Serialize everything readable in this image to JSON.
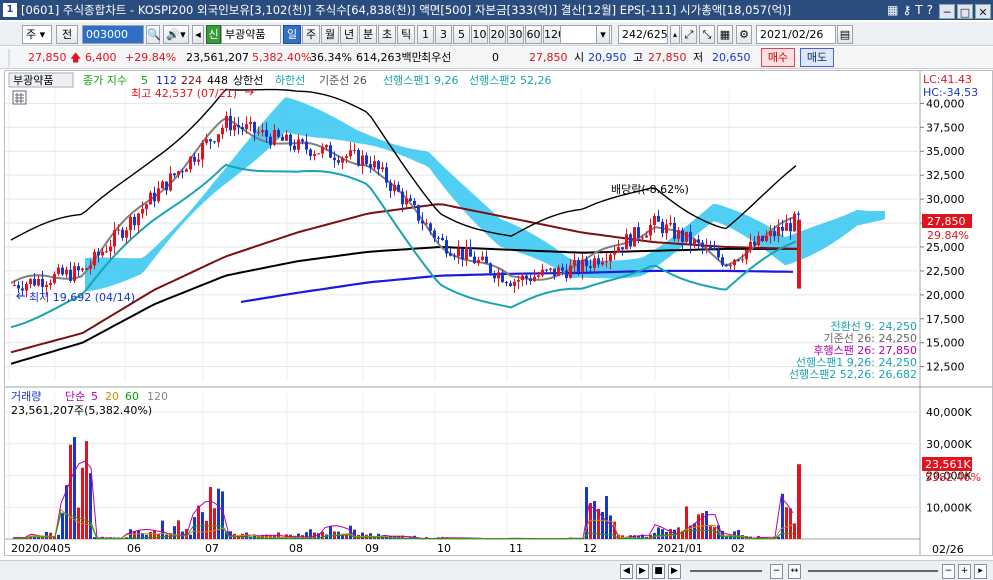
{
  "window": {
    "number": "1",
    "title": "[0601] 주식종합차트 - KOSPI200 외국인보유[3,102(천)] 주식수[64,838(천)] 액면[500] 자본금[333(억)] 결산[12월] EPS[-111] 시가총액[18,057(억)]",
    "icons": [
      "grid-icon",
      "key-icon",
      "help-icon",
      "menu-icon"
    ],
    "icon_glyphs": [
      "▦",
      "⚷",
      "T",
      "?"
    ],
    "controls": [
      "─",
      "□",
      "✕"
    ]
  },
  "toolbar": {
    "market_select": "주",
    "prev_label": "전",
    "code": "003000",
    "stock_name": "부광약품",
    "stock_badge": "신",
    "period_buttons": [
      "일",
      "주",
      "월",
      "년",
      "분",
      "초",
      "틱"
    ],
    "active_period": "일",
    "interval_buttons": [
      "1",
      "3",
      "5",
      "10",
      "20",
      "30",
      "60",
      "120"
    ],
    "page_count": "242",
    "page_total": "/625",
    "date": "2021/02/26"
  },
  "quote": {
    "price": "27,850",
    "change": "6,400",
    "change_pct": "+29.84%",
    "volume": "23,561,207",
    "volume_pct": "5,382.40%",
    "turnover": "36.34%",
    "amount": "614,263백만",
    "pref_label": "최우선",
    "pref_value": "0",
    "ask": "27,850",
    "open_label": "시",
    "open": "20,950",
    "high_label": "고",
    "high": "27,850",
    "low_label": "저",
    "low": "20,650",
    "buy_label": "매수",
    "sell_label": "매도"
  },
  "colors": {
    "up": "#e0141e",
    "down": "#1637c9",
    "ichimoku_cloud": "#33c6f2",
    "bollinger": "#000000",
    "ma_gray": "#7f7f7f",
    "ma_darkred": "#7a1010",
    "ma_blue": "#1a1ae0"
  },
  "legend": {
    "name": "부광약품",
    "ma_label": "종가 지수",
    "ma_periods": [
      "5",
      "112",
      "224",
      "448"
    ],
    "upper_band": "상한선",
    "lower_band": "하한선",
    "base_line": "기준선 26",
    "span1": "선행스팬1 9,26",
    "span2": "선행스팬2 52,26",
    "lc": "LC:41.43",
    "hc": "HC:-34.53"
  },
  "annotations": {
    "high": "최고 42,537 (07/21)",
    "low": "최저 19,692 (04/14)",
    "dividend": "배당락(-8.62%)",
    "price_tag": "27,850",
    "pct_tag": "29.84%"
  },
  "ichimoku_values": [
    "전환선 9: 24,250",
    "기준선 26: 24,250",
    "후행스팬 26: 27,850",
    "선행스팬1 9,26: 24,250",
    "선행스팬2 52,26: 26,682"
  ],
  "volume_panel": {
    "title": "거래량",
    "ma_label": "단순",
    "ma_periods": [
      "5",
      "20",
      "60",
      "120"
    ],
    "info": "23,561,207주(5,382.40%)",
    "tag_value": "23,561K",
    "tag_pct": "5382.40%"
  },
  "x_labels": [
    "2020/04",
    "05",
    "06",
    "07",
    "08",
    "09",
    "10",
    "11",
    "12",
    "2021/01",
    "02"
  ],
  "end_date": "02/26",
  "chart_data": [
    {
      "type": "candlestick",
      "title": "부광약품",
      "xlabel": "",
      "ylabel": "",
      "ylim": [
        11000,
        41500
      ],
      "y_ticks": [
        "40,000",
        "37,500",
        "35,000",
        "32,500",
        "30,000",
        "27,500",
        "25,000",
        "22,500",
        "20,000",
        "17,500",
        "15,000",
        "12,500"
      ],
      "x": [
        "2020/04",
        "05",
        "06",
        "07",
        "08",
        "09",
        "10",
        "11",
        "12",
        "2021/01",
        "02",
        "02/26"
      ],
      "series": [
        {
          "name": "close",
          "values": [
            21000,
            22500,
            30500,
            38000,
            35500,
            34000,
            25500,
            21500,
            23000,
            27500,
            23500,
            27850
          ]
        },
        {
          "name": "448",
          "values": [
            12800,
            15000,
            19000,
            22000,
            23500,
            24500,
            25000,
            24700,
            24400,
            24600,
            24800,
            24800
          ]
        },
        {
          "name": "224",
          "values": [
            14000,
            16000,
            20500,
            24000,
            26500,
            28500,
            29500,
            28000,
            26500,
            25500,
            25000,
            24800
          ]
        },
        {
          "name": "112",
          "values": [
            null,
            null,
            null,
            19000,
            20200,
            21300,
            22000,
            22200,
            22300,
            22500,
            22500,
            22400
          ]
        }
      ],
      "markers": {
        "high": {
          "date": "07/21",
          "value": 42537
        },
        "low": {
          "date": "04/14",
          "value": 19692
        },
        "last": 27850
      }
    },
    {
      "type": "bar",
      "title": "거래량",
      "xlabel": "",
      "ylabel": "",
      "ylim": [
        0,
        46000
      ],
      "y_ticks": [
        "40,000K",
        "30,000K",
        "20,000K",
        "10,000K"
      ],
      "series": [
        {
          "name": "거래량",
          "values": [
            800,
            3000,
            41000,
            900,
            5000,
            6000,
            20000,
            4000,
            2000,
            3000,
            7000,
            2500,
            1500,
            800,
            600,
            400,
            300,
            500,
            18000,
            2000,
            8000,
            13000,
            4000,
            1000,
            23561
          ]
        }
      ]
    }
  ]
}
